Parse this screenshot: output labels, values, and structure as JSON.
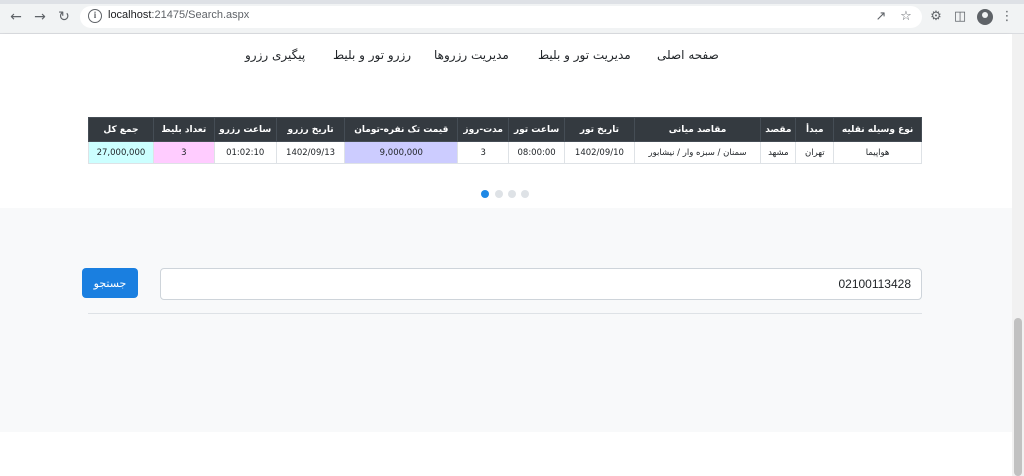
{
  "browser": {
    "url_host": "localhost",
    "url_rest": ":21475/Search.aspx"
  },
  "nav": {
    "home": "صفحه اصلی",
    "manage_tours": "مدیریت تور و بلیط",
    "manage_reservations": "مدیریت رزروها",
    "reserve": "رزرو تور و بلیط",
    "tracking": "پیگیری رزرو"
  },
  "carousel": {
    "slides": 4,
    "active_index": 0
  },
  "search": {
    "value": "02100113428",
    "button_label": "جستجو"
  },
  "colors": {
    "accent": "#1a7fe0",
    "unit_price_bg": "#ccccff",
    "ticket_count_bg": "#ffccff",
    "total_bg": "#ccffff"
  },
  "table": {
    "headers": [
      "نوع وسیله نقلیه",
      "مبدأ",
      "مقصد",
      "مقاصد میانی",
      "تاریخ تور",
      "ساعت تور",
      "مدت-روز",
      "قیمت تک نفره-تومان",
      "تاریخ رزرو",
      "ساعت رزرو",
      "تعداد بلیط",
      "جمع کل"
    ],
    "rows": [
      [
        "هواپیما",
        "تهران",
        "مشهد",
        "سمنان / سبزه وار / نیشابور",
        "1402/09/10",
        "08:00:00",
        "3",
        "9,000,000",
        "1402/09/13",
        "01:02:10",
        "3",
        "27,000,000"
      ]
    ]
  }
}
